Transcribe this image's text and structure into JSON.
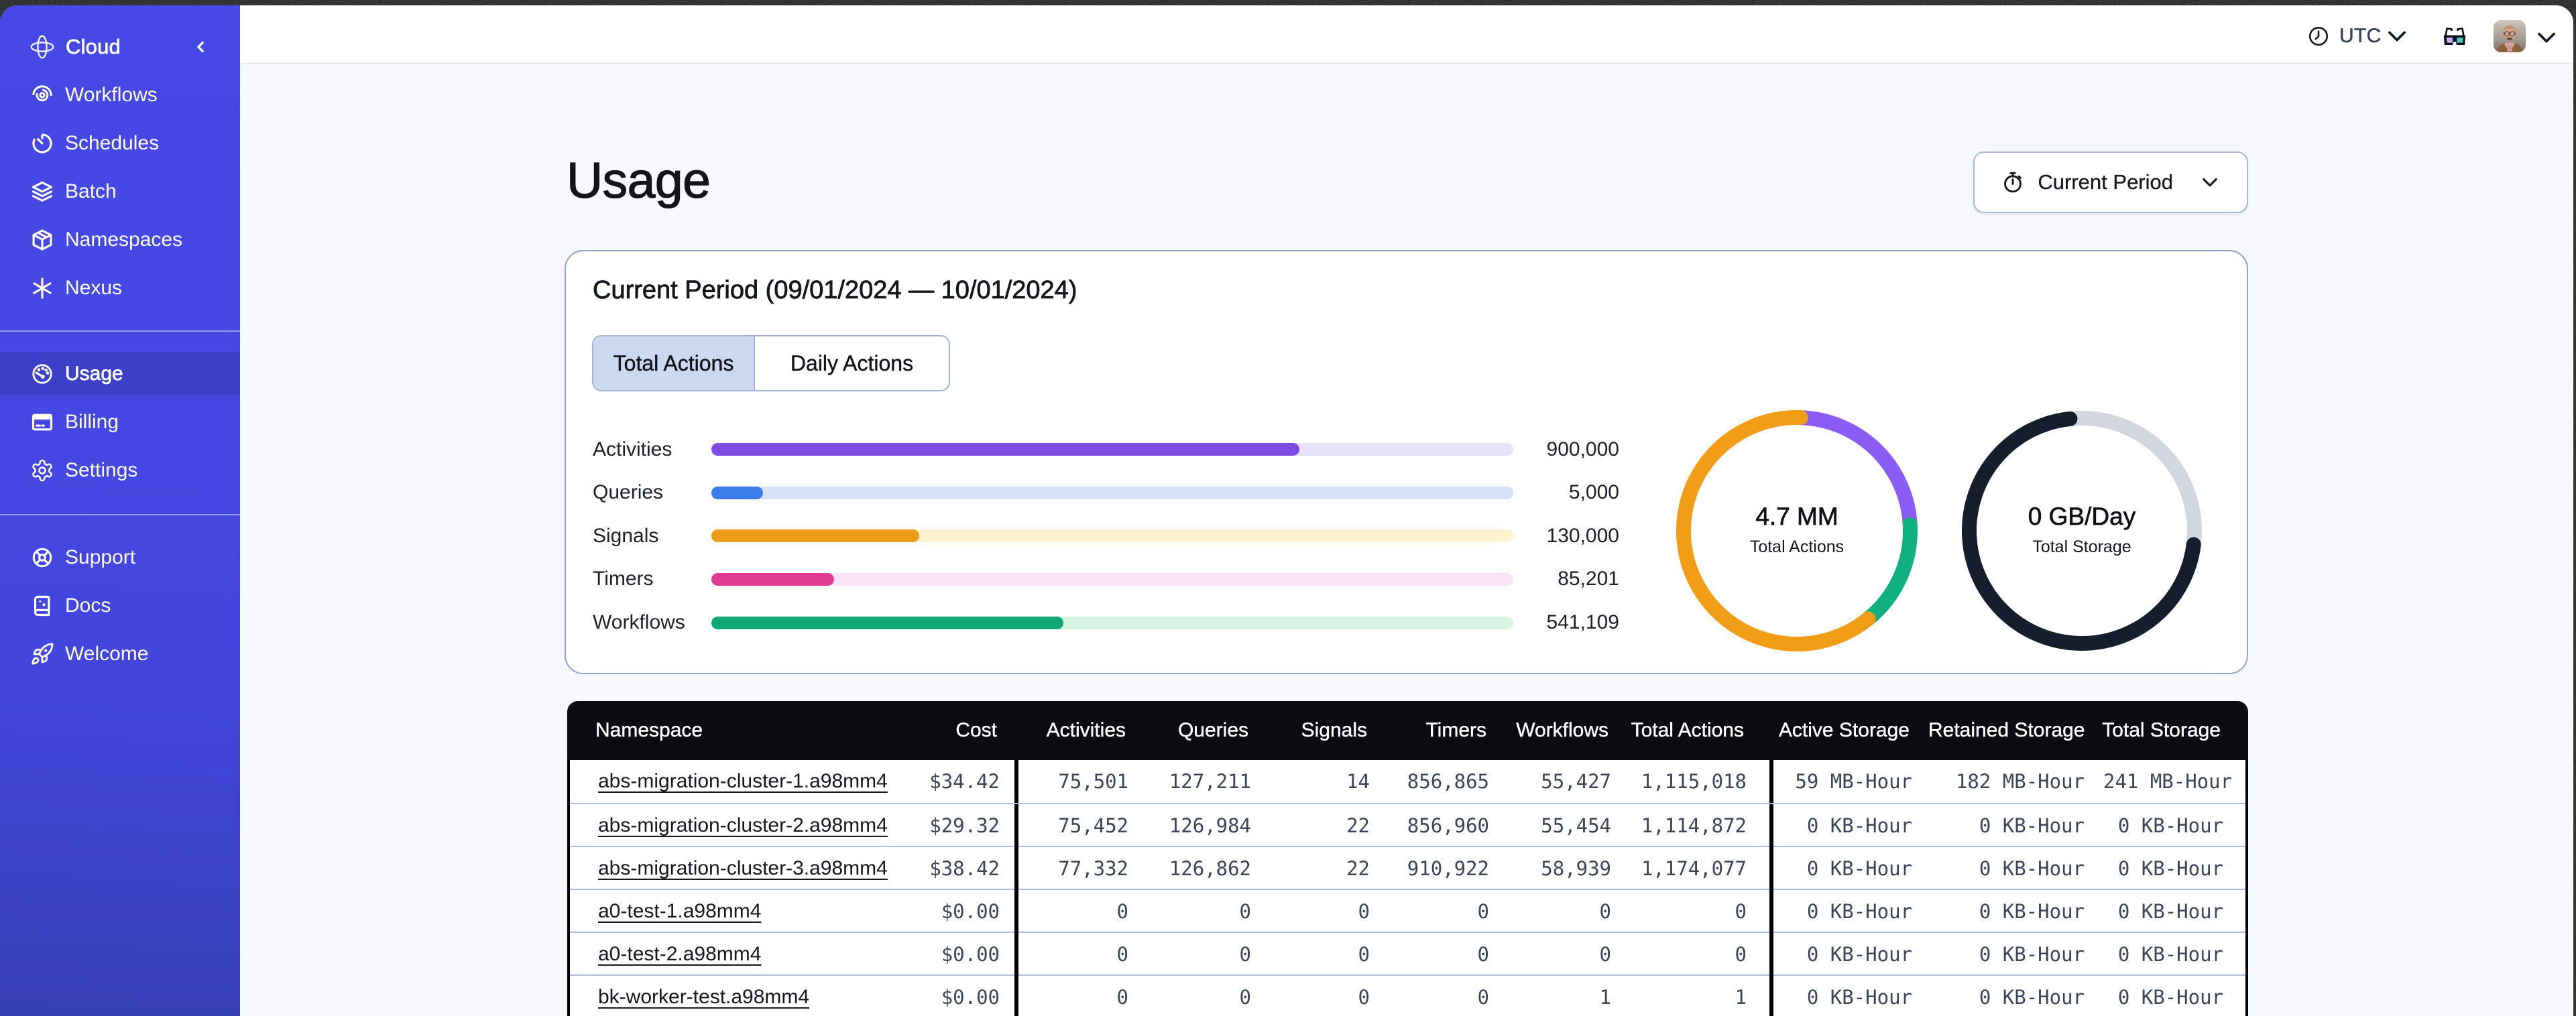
{
  "brand": {
    "label": "Cloud"
  },
  "sidebar": {
    "groups": [
      {
        "items": [
          {
            "icon": "workflows",
            "label": "Workflows",
            "active": false
          },
          {
            "icon": "schedules",
            "label": "Schedules",
            "active": false
          },
          {
            "icon": "batch",
            "label": "Batch",
            "active": false
          },
          {
            "icon": "namespaces",
            "label": "Namespaces",
            "active": false
          },
          {
            "icon": "nexus",
            "label": "Nexus",
            "active": false
          }
        ]
      },
      {
        "items": [
          {
            "icon": "usage",
            "label": "Usage",
            "active": true
          },
          {
            "icon": "billing",
            "label": "Billing",
            "active": false
          },
          {
            "icon": "settings",
            "label": "Settings",
            "active": false
          }
        ]
      },
      {
        "items": [
          {
            "icon": "support",
            "label": "Support",
            "active": false
          },
          {
            "icon": "docs",
            "label": "Docs",
            "active": false
          },
          {
            "icon": "welcome",
            "label": "Welcome",
            "active": false
          }
        ]
      }
    ]
  },
  "topbar": {
    "timezone": "UTC"
  },
  "page": {
    "title": "Usage",
    "period_button_label": "Current Period"
  },
  "usage_card": {
    "heading": "Current Period (09/01/2024 — 10/01/2024)",
    "tabs": [
      {
        "label": "Total Actions",
        "active": true
      },
      {
        "label": "Daily Actions",
        "active": false
      }
    ]
  },
  "chart_data": [
    {
      "type": "bar",
      "title": "Usage by action type",
      "categories": [
        "Activities",
        "Queries",
        "Signals",
        "Timers",
        "Workflows"
      ],
      "values": [
        900000,
        5000,
        130000,
        85201,
        541109
      ],
      "value_labels": [
        "900,000",
        "5,000",
        "130,000",
        "85,201",
        "541,109"
      ],
      "fill_percent": [
        73.3,
        6.4,
        25.9,
        15.3,
        43.9
      ],
      "bar_colors": [
        "#7e4be4",
        "#3a7de8",
        "#ee9d18",
        "#e13a92",
        "#10a877"
      ],
      "track_colors": [
        "#e8e2fa",
        "#d6e2f8",
        "#fdf3d0",
        "#fbe3f7",
        "#d6f5e5"
      ],
      "xlabel": "",
      "ylabel": "",
      "legend": false,
      "grid": false
    },
    {
      "type": "pie",
      "title": "Total Actions donut",
      "center_value": "4.7 MM",
      "center_label": "Total Actions",
      "slices": [
        {
          "name": "purple",
          "start_deg": 2,
          "end_deg": 87,
          "color": "#8a5cf5",
          "cap": "round"
        },
        {
          "name": "green",
          "start_deg": 87,
          "end_deg": 141,
          "color": "#10b07f",
          "cap": "round"
        },
        {
          "name": "orange",
          "start_deg": 141,
          "end_deg": 362,
          "color": "#f19d15",
          "cap": "round"
        }
      ]
    },
    {
      "type": "pie",
      "title": "Total Storage donut",
      "center_value": "0 GB/Day",
      "center_label": "Total Storage",
      "base_color": "#d3d6dc",
      "slices": [
        {
          "name": "used",
          "start_deg": 97,
          "end_deg": 354,
          "color": "#161e2e",
          "cap": "round"
        }
      ]
    }
  ],
  "table": {
    "columns": [
      {
        "key": "namespace",
        "label": "Namespace"
      },
      {
        "key": "cost",
        "label": "Cost"
      },
      {
        "key": "activities",
        "label": "Activities"
      },
      {
        "key": "queries",
        "label": "Queries"
      },
      {
        "key": "signals",
        "label": "Signals"
      },
      {
        "key": "timers",
        "label": "Timers"
      },
      {
        "key": "workflows",
        "label": "Workflows"
      },
      {
        "key": "total_actions",
        "label": "Total Actions"
      },
      {
        "key": "active_storage",
        "label": "Active Storage"
      },
      {
        "key": "retained_storage",
        "label": "Retained Storage"
      },
      {
        "key": "total_storage",
        "label": "Total Storage"
      }
    ],
    "rows": [
      [
        "abs-migration-cluster-1.a98mm4",
        "$34.42",
        "75,501",
        "127,211",
        "14",
        "856,865",
        "55,427",
        "1,115,018",
        "59 MB-Hour",
        "182 MB-Hour",
        "241 MB-Hour"
      ],
      [
        "abs-migration-cluster-2.a98mm4",
        "$29.32",
        "75,452",
        "126,984",
        "22",
        "856,960",
        "55,454",
        "1,114,872",
        "0 KB-Hour",
        "0 KB-Hour",
        "0 KB-Hour"
      ],
      [
        "abs-migration-cluster-3.a98mm4",
        "$38.42",
        "77,332",
        "126,862",
        "22",
        "910,922",
        "58,939",
        "1,174,077",
        "0 KB-Hour",
        "0 KB-Hour",
        "0 KB-Hour"
      ],
      [
        "a0-test-1.a98mm4",
        "$0.00",
        "0",
        "0",
        "0",
        "0",
        "0",
        "0",
        "0 KB-Hour",
        "0 KB-Hour",
        "0 KB-Hour"
      ],
      [
        "a0-test-2.a98mm4",
        "$0.00",
        "0",
        "0",
        "0",
        "0",
        "0",
        "0",
        "0 KB-Hour",
        "0 KB-Hour",
        "0 KB-Hour"
      ],
      [
        "bk-worker-test.a98mm4",
        "$0.00",
        "0",
        "0",
        "0",
        "0",
        "1",
        "1",
        "0 KB-Hour",
        "0 KB-Hour",
        "0 KB-Hour"
      ]
    ]
  }
}
